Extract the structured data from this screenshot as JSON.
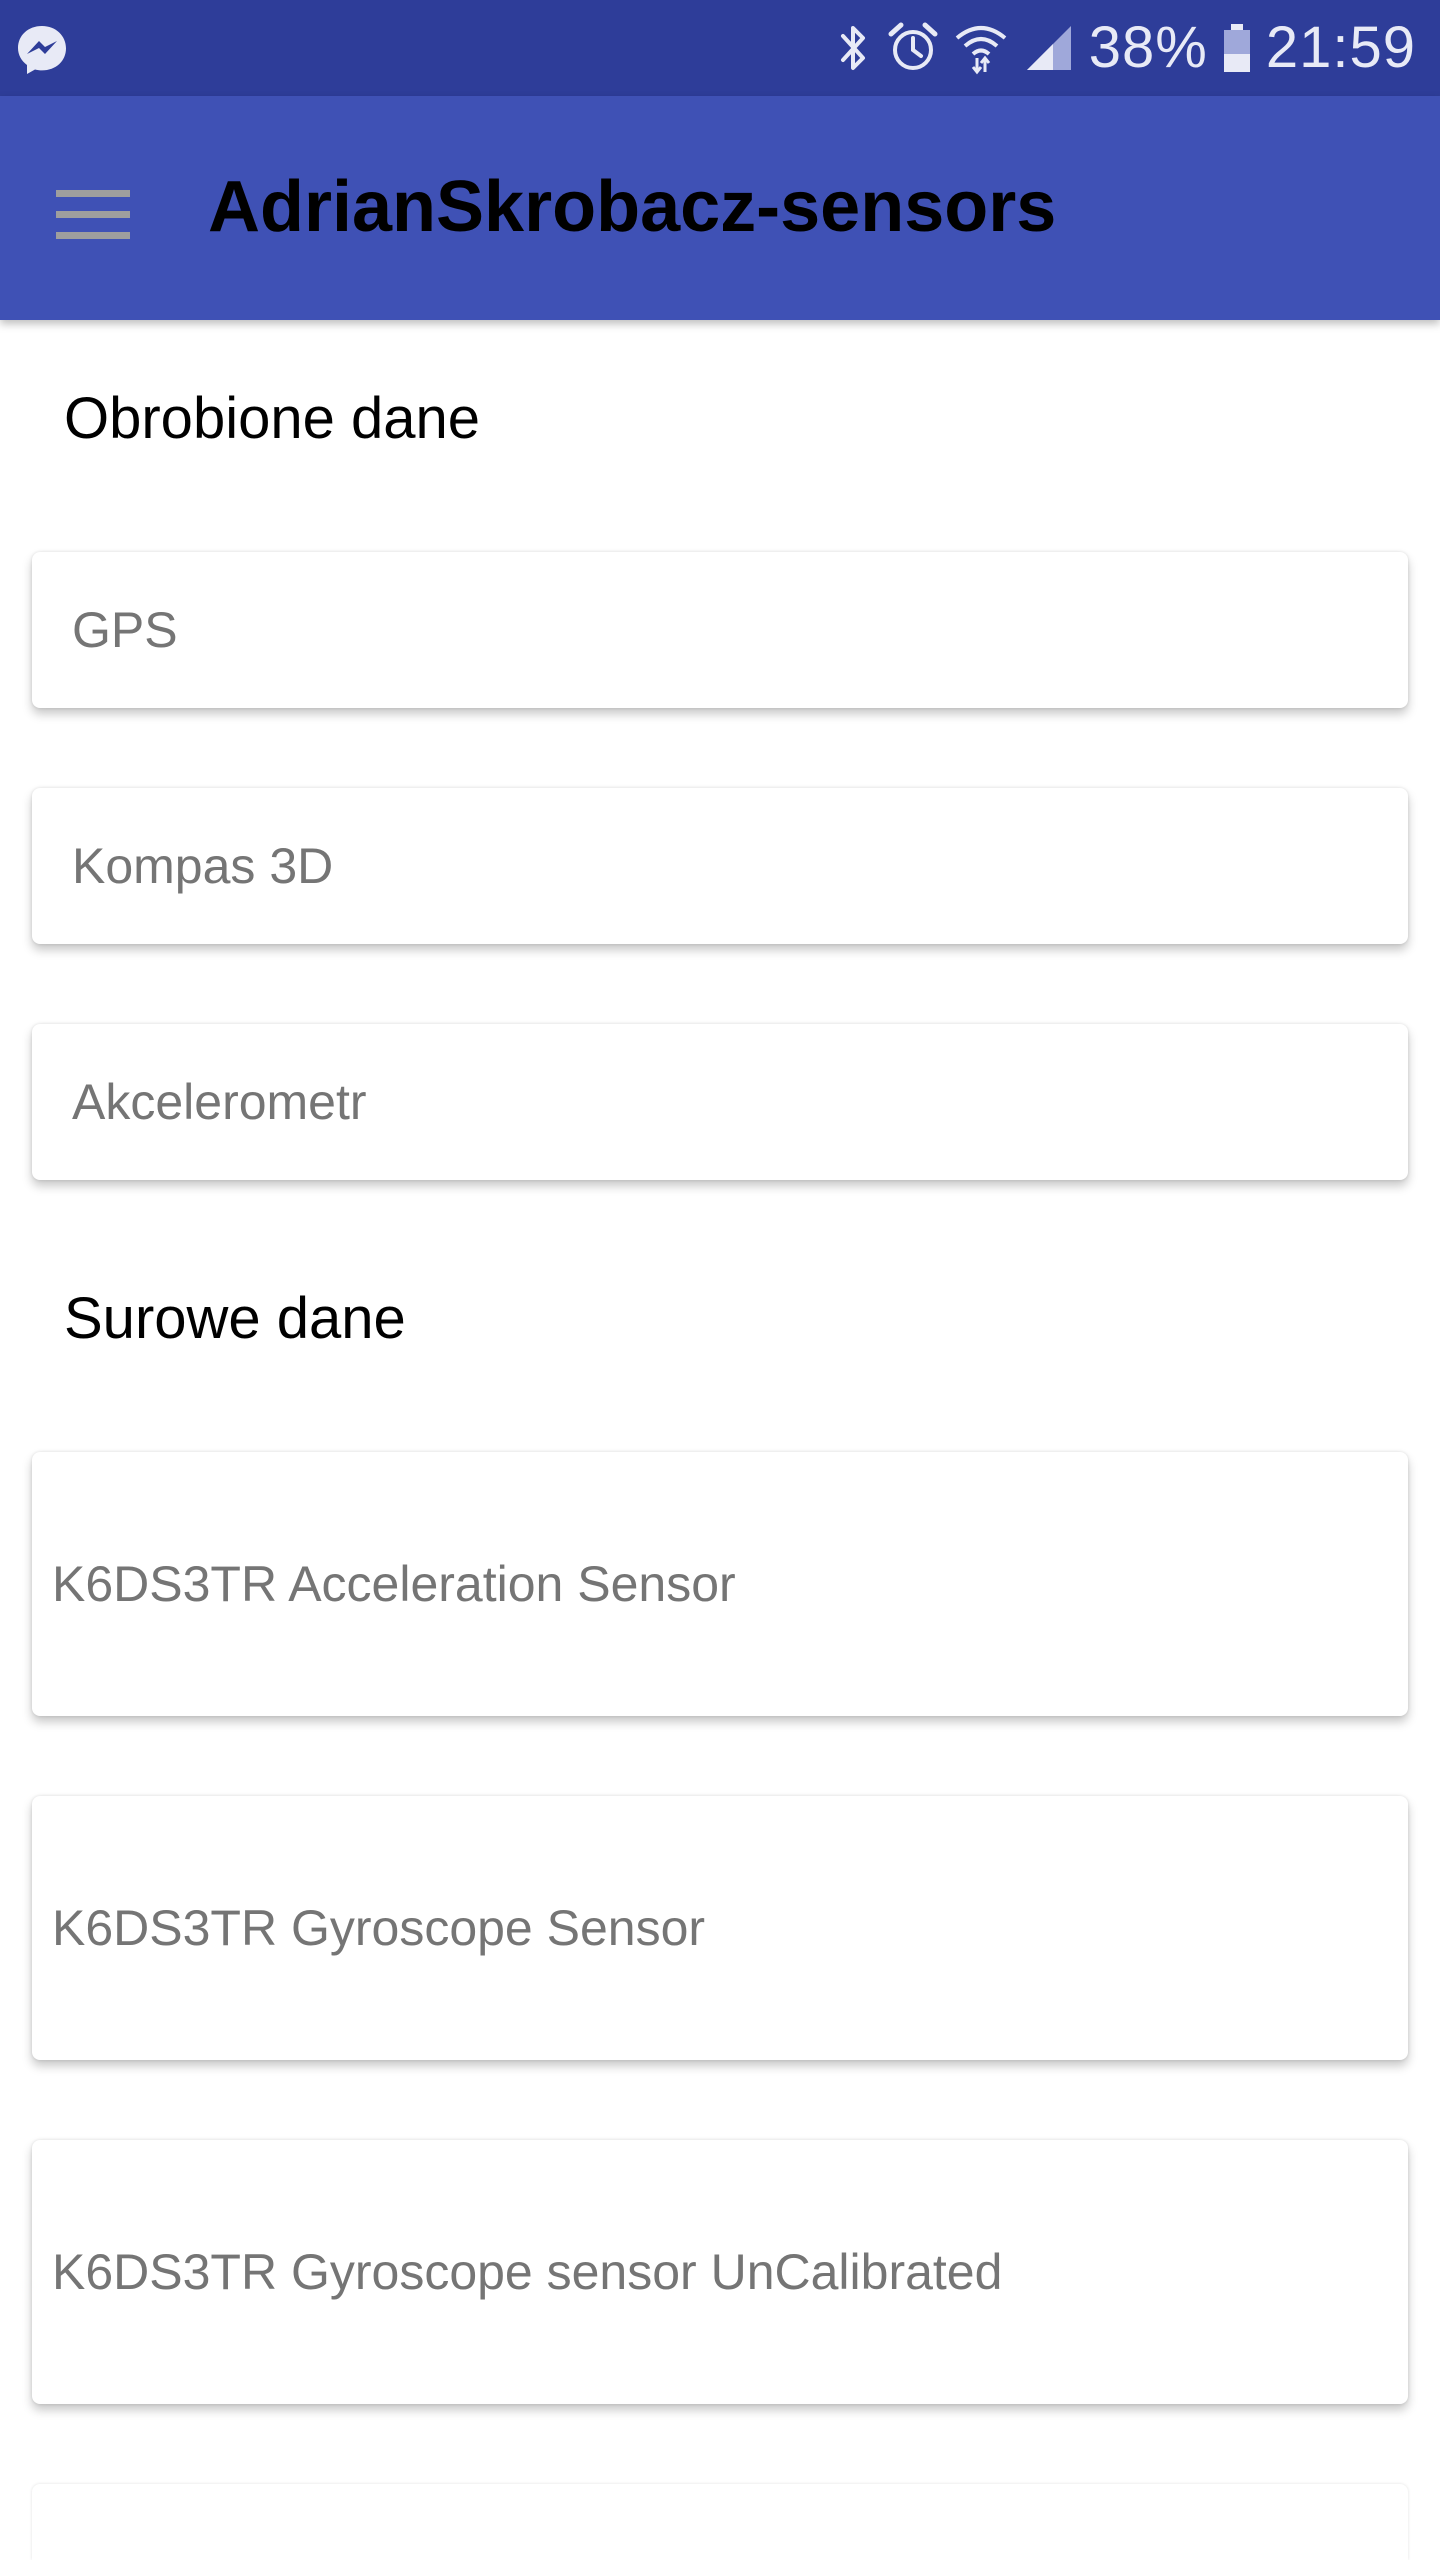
{
  "status_bar": {
    "battery_percent": "38%",
    "time": "21:59",
    "icons": [
      "messenger-icon",
      "bluetooth-icon",
      "alarm-icon",
      "wifi-icon",
      "signal-icon",
      "battery-icon"
    ]
  },
  "app_bar": {
    "title": "AdrianSkrobacz-sensors",
    "menu_icon": "hamburger-menu-icon",
    "color": "#3f51b5"
  },
  "sections": {
    "processed": {
      "header": "Obrobione dane",
      "items": [
        "GPS",
        "Kompas 3D",
        "Akcelerometr"
      ]
    },
    "raw": {
      "header": "Surowe dane",
      "items": [
        "K6DS3TR Acceleration Sensor",
        "K6DS3TR Gyroscope Sensor",
        "K6DS3TR Gyroscope sensor UnCalibrated"
      ]
    }
  }
}
